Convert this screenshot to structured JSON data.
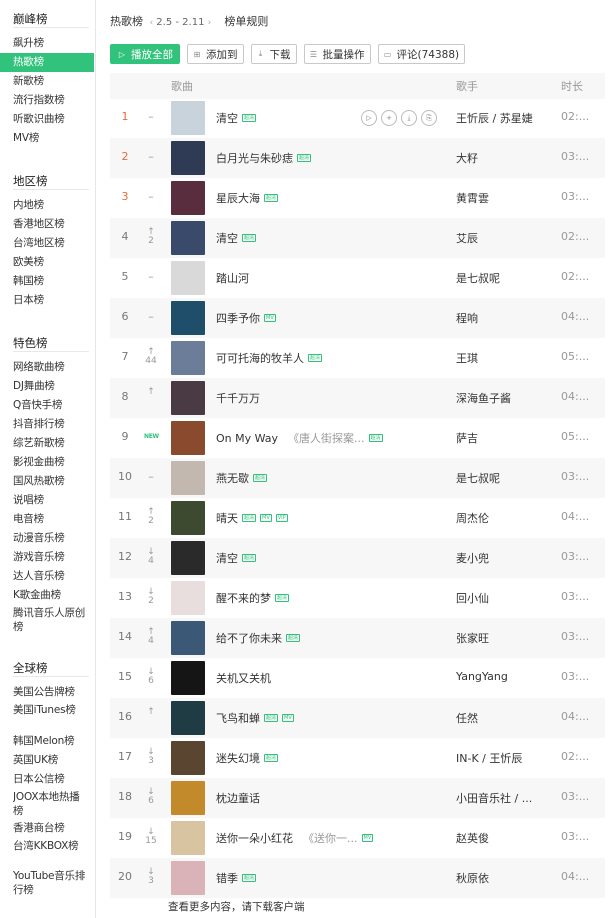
{
  "sidebar": {
    "groups": [
      {
        "title": "巅峰榜",
        "items": [
          "飙升榜",
          "热歌榜",
          "新歌榜",
          "流行指数榜",
          "听歌识曲榜",
          "MV榜"
        ],
        "active": 1
      },
      {
        "title": "地区榜",
        "items": [
          "内地榜",
          "香港地区榜",
          "台湾地区榜",
          "欧美榜",
          "韩国榜",
          "日本榜"
        ]
      },
      {
        "title": "特色榜",
        "items": [
          "网络歌曲榜",
          "DJ舞曲榜",
          "Q音快手榜",
          "抖音排行榜",
          "综艺新歌榜",
          "影视金曲榜",
          "国风热歌榜",
          "说唱榜",
          "电音榜",
          "动漫音乐榜",
          "游戏音乐榜",
          "达人音乐榜",
          "K歌金曲榜",
          "腾讯音乐人原创榜"
        ]
      },
      {
        "title": "全球榜",
        "items": [
          "美国公告牌榜",
          "美国iTunes榜",
          "韩国Melon榜",
          "英国UK榜",
          "日本公信榜",
          "JOOX本地热播榜",
          "香港商台榜",
          "台湾KKBOX榜",
          "YouTube音乐排行榜"
        ]
      }
    ]
  },
  "header": {
    "title": "热歌榜",
    "date_range": "2.5 - 2.11",
    "prev_arrow": "‹",
    "next_arrow": "›",
    "rules_link": "榜单规则"
  },
  "toolbar": {
    "play_all": "播放全部",
    "add_to": "添加到",
    "download": "下载",
    "batch": "批量操作",
    "comments": "评论(74388)"
  },
  "table": {
    "col_song": "歌曲",
    "col_singer": "歌手",
    "col_duration": "时长"
  },
  "accent_color": "#31c27c",
  "top_rank_color": "#e56b3c",
  "songs": [
    {
      "rank": "1",
      "trend": "–",
      "title": "清空",
      "album": "",
      "badges": [
        "超清"
      ],
      "singer": "王忻辰 / 苏星婕",
      "duration": "02:...",
      "cover": "#c8d3dc"
    },
    {
      "rank": "2",
      "trend": "–",
      "title": "白月光与朱砂痣",
      "album": "",
      "badges": [
        "超清"
      ],
      "singer": "大籽",
      "duration": "03:...",
      "cover": "#2f3a55"
    },
    {
      "rank": "3",
      "trend": "–",
      "title": "星辰大海",
      "album": "",
      "badges": [
        "超清"
      ],
      "singer": "黄霄雲",
      "duration": "03:...",
      "cover": "#5a2d3e"
    },
    {
      "rank": "4",
      "trend": "up",
      "trend_num": "2",
      "title": "清空",
      "album": "",
      "badges": [
        "超清"
      ],
      "singer": "艾辰",
      "duration": "02:...",
      "cover": "#3a4a6a"
    },
    {
      "rank": "5",
      "trend": "–",
      "title": "踏山河",
      "album": "",
      "badges": [],
      "singer": "是七叔呢",
      "duration": "02:...",
      "cover": "#d9d9d9"
    },
    {
      "rank": "6",
      "trend": "–",
      "title": "四季予你",
      "album": "",
      "badges": [
        "MV"
      ],
      "singer": "程响",
      "duration": "04:...",
      "cover": "#1f4e6a"
    },
    {
      "rank": "7",
      "trend": "up",
      "trend_num": "44",
      "title": "可可托海的牧羊人",
      "album": "",
      "badges": [
        "超清"
      ],
      "singer": "王琪",
      "duration": "05:...",
      "cover": "#6b7d98"
    },
    {
      "rank": "8",
      "trend": "up",
      "trend_num": "",
      "title": "千千万万",
      "album": "",
      "badges": [],
      "singer": "深海鱼子酱",
      "duration": "04:...",
      "cover": "#4a3a44"
    },
    {
      "rank": "9",
      "trend": "new",
      "title": "On My Way",
      "album": "《唐人街探案...",
      "badges": [
        "超清"
      ],
      "singer": "萨吉",
      "duration": "05:...",
      "cover": "#8a4a2e"
    },
    {
      "rank": "10",
      "trend": "–",
      "title": "燕无歇",
      "album": "",
      "badges": [
        "超清"
      ],
      "singer": "是七叔呢",
      "duration": "03:...",
      "cover": "#c2b8b0"
    },
    {
      "rank": "11",
      "trend": "up",
      "trend_num": "2",
      "title": "晴天",
      "album": "",
      "badges": [
        "超清",
        "MV",
        "VIP"
      ],
      "singer": "周杰伦",
      "duration": "04:...",
      "cover": "#3e4a2f"
    },
    {
      "rank": "12",
      "trend": "down",
      "trend_num": "4",
      "title": "清空",
      "album": "",
      "badges": [
        "超清"
      ],
      "singer": "麦小兜",
      "duration": "03:...",
      "cover": "#2a2a2a"
    },
    {
      "rank": "13",
      "trend": "down",
      "trend_num": "2",
      "title": "醒不来的梦",
      "album": "",
      "badges": [
        "超清"
      ],
      "singer": "回小仙",
      "duration": "03:...",
      "cover": "#e8dede"
    },
    {
      "rank": "14",
      "trend": "up",
      "trend_num": "4",
      "title": "给不了你未来",
      "album": "",
      "badges": [
        "超清"
      ],
      "singer": "张家旺",
      "duration": "03:...",
      "cover": "#3b5876"
    },
    {
      "rank": "15",
      "trend": "down",
      "trend_num": "6",
      "title": "关机又关机",
      "album": "",
      "badges": [],
      "singer": "YangYang",
      "duration": "03:...",
      "cover": "#151515"
    },
    {
      "rank": "16",
      "trend": "up",
      "trend_num": "",
      "title": "飞鸟和蝉",
      "album": "",
      "badges": [
        "超清",
        "MV"
      ],
      "singer": "任然",
      "duration": "04:...",
      "cover": "#1f3b44"
    },
    {
      "rank": "17",
      "trend": "down",
      "trend_num": "3",
      "title": "迷失幻境",
      "album": "",
      "badges": [
        "超清"
      ],
      "singer": "IN-K / 王忻辰",
      "duration": "02:...",
      "cover": "#5a4530"
    },
    {
      "rank": "18",
      "trend": "down",
      "trend_num": "6",
      "title": "枕边童话",
      "album": "",
      "badges": [],
      "singer": "小田音乐社 / ...",
      "duration": "03:...",
      "cover": "#c28a2a"
    },
    {
      "rank": "19",
      "trend": "down",
      "trend_num": "15",
      "title": "送你一朵小红花",
      "album": "《送你一...",
      "badges": [
        "MV"
      ],
      "singer": "赵英俊",
      "duration": "03:...",
      "cover": "#d8c4a0"
    },
    {
      "rank": "20",
      "trend": "down",
      "trend_num": "3",
      "title": "错季",
      "album": "",
      "badges": [
        "超清"
      ],
      "singer": "秋原依",
      "duration": "04:...",
      "cover": "#d9b3b8"
    }
  ],
  "footer_text": "查看更多内容，请下载客户端"
}
